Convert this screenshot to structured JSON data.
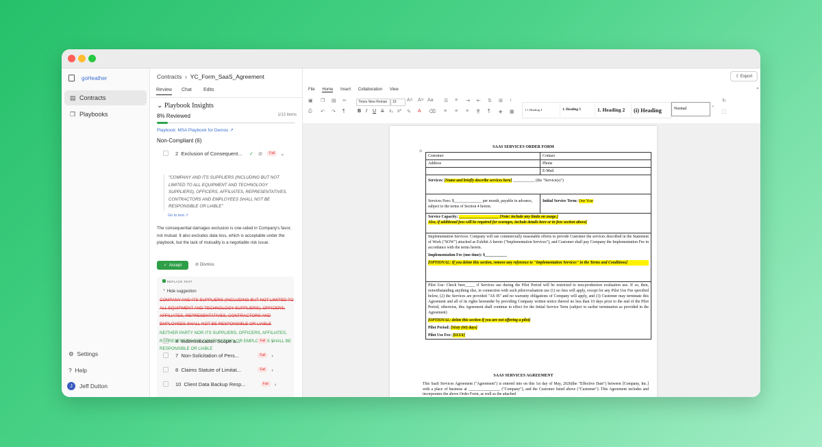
{
  "app": {
    "name": "goHeather"
  },
  "sidebar": {
    "items": [
      {
        "label": "Contracts"
      },
      {
        "label": "Playbooks"
      }
    ],
    "settings": "Settings",
    "help": "Help",
    "user": "Jeff Dutton",
    "user_initial": "J"
  },
  "breadcrumb": {
    "root": "Contracts",
    "current": "YC_Form_SaaS_Agreement"
  },
  "tabs": [
    "Review",
    "Chat",
    "Edits"
  ],
  "insights": {
    "title": "Playbook Insights",
    "reviewed": "8% Reviewed",
    "count": "1/13 items",
    "progress": 0.08,
    "playbook_link": "Playbook: MSA Playbook for Demos",
    "noncompliant": "Non-Compliant (6)",
    "issue_open": {
      "num": "2",
      "title": "Exclusion of Consequent...",
      "status": "Fail"
    },
    "quote": "\"COMPANY AND ITS SUPPLIERS (INCLUDING BUT NOT LIMITED TO ALL EQUIPMENT AND TECHNOLOGY SUPPLIERS), OFFICERS, AFFILIATES, REPRESENTATIVES, CONTRACTORS AND EMPLOYEES SHALL NOT BE RESPONSIBLE OR LIABLE\"",
    "goto": "Go to text ↗",
    "explanation": "The consequential damages exclusion is one-sided in Company's favor, not mutual. It also excludes data loss, which is acceptable under the playbook, but the lack of mutuality is a negotiable risk issue.",
    "accept": "Accept",
    "dismiss": "Dismiss",
    "replace_label": "REPLACE TEXT",
    "hide": "Hide suggestion",
    "deleted": "COMPANY AND ITS SUPPLIERS (INCLUDING BUT NOT LIMITED TO ALL EQUIPMENT AND TECHNOLOGY SUPPLIERS), OFFICERS, AFFILIATES, REPRESENTATIVES, CONTRACTORS AND EMPLOYEES SHALL NOT BE RESPONSIBLE OR LIABLE",
    "inserted": "NEITHER PARTY NOR ITS SUPPLIERS, OFFICERS, AFFILIATES, REPRESENTATIVES, CONTRACTORS OR EMPLOYEES SHALL BE RESPONSIBLE OR LIABLE",
    "issues": [
      {
        "num": "4",
        "title": "Indemnification Scope a...",
        "status": "Fail"
      },
      {
        "num": "7",
        "title": "Non-Solicitation of Pers...",
        "status": "Fail"
      },
      {
        "num": "8",
        "title": "Claims Statute of Limitat...",
        "status": "Fail"
      },
      {
        "num": "10",
        "title": "Client Data Backup Resp...",
        "status": "Fail"
      }
    ]
  },
  "editor": {
    "export": "Export",
    "menus": [
      "File",
      "Home",
      "Insert",
      "Collaboration",
      "View"
    ],
    "font": "Times New Roman",
    "size": "10",
    "styles": [
      "1.1 Heading 4",
      "1. Heading 3",
      "1. Heading 2",
      "(i) Heading",
      "Normal"
    ]
  },
  "doc": {
    "title1": "SAAS SERVICES ORDER FORM",
    "customer": "Customer",
    "contact": "Contact",
    "address": "Address",
    "phone": "Phone",
    "email": "E-Mail",
    "services_label": "Services:",
    "services_hl": "[Name and briefly describe services here]",
    "services_tail": "___________ (the \"Service(s)\")",
    "fees": "Services Fees: $______________ per month, payable in advance, subject to the terms of Section 4 herein.",
    "term_label": "Initial Service Term:",
    "term_hl": "One Year",
    "capacity_label": "Service Capacity:",
    "capacity_hl": "____________________ [Note: include any limits on usage.]",
    "capacity_hl2": "Also, if additional fees will be required for overages, include details here or in fees section above]",
    "impl": "Implementation Services: Company will use commercially reasonable efforts to provide Customer the services described in the Statement of Work (\"SOW\") attached as Exhibit A hereto (\"Implementation Services\"), and Customer shall pay Company the Implementation Fee in accordance with the terms herein.",
    "impl_fee": "Implementation Fee (one-time): $___________",
    "impl_opt": "[OPTIONAL: If you delete this section, remove any reference to \"Implementation Services\" in the Terms and Conditions]",
    "pilot": "Pilot Use: Check here_____ if Services use during the Pilot Period will be restricted to non-production evaluation use. If so, then, notwithstanding anything else, in connection with such pilot/evaluation use (1) no fees will apply, except for any Pilot Use Fee specified below, (2) the Services are provided \"AS IS\" and no warranty obligations of Company will apply, and (3) Customer may terminate this Agreement and all of its rights hereunder by providing Company written notice thereof no less than 10 days prior to the end of the Pilot Period, otherwise, this Agreement shall continue in effect for the Initial Service Term (subject to earlier termination as provided in the Agreement)",
    "pilot_opt": "[OPTIONAL: delete this section if you are not offering a pilot]",
    "pilot_period_label": "Pilot Period:",
    "pilot_period_hl": "[Sixty (60) days]",
    "pilot_fee_label": "Pilot Use Fee:",
    "pilot_fee_hl": "[$XXX]",
    "title2": "SAAS SERVICES AGREEMENT",
    "body": "This SaaS Services Agreement (\"Agreement\") is entered into on this 1st day of May, 2026(the \"Effective Date\") between [Company, Inc.] with a place of business at ________________ (\"Company\"), and the Customer listed above (\"Customer\"). This Agreement includes and incorporates the above Order Form, as well as the attached"
  }
}
